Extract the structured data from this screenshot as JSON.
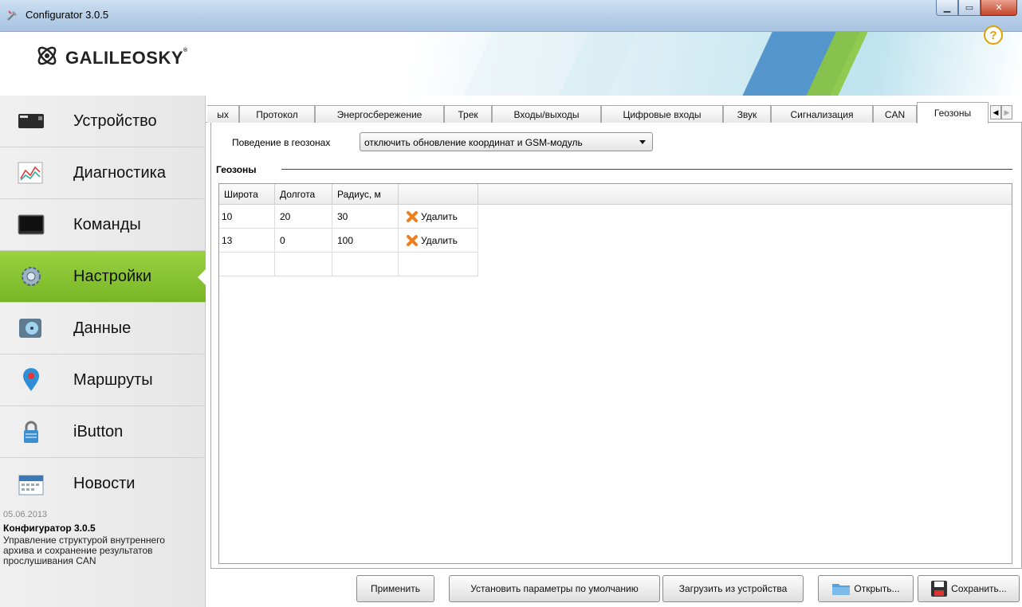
{
  "window": {
    "title": "Configurator 3.0.5"
  },
  "header": {
    "brand": "GALILEOSKY",
    "brand_mark": "®"
  },
  "sidebar": {
    "items": [
      {
        "label": "Устройство",
        "icon": "device-icon"
      },
      {
        "label": "Диагностика",
        "icon": "diagnostics-icon"
      },
      {
        "label": "Команды",
        "icon": "console-icon"
      },
      {
        "label": "Настройки",
        "icon": "gear-icon",
        "active": true
      },
      {
        "label": "Данные",
        "icon": "data-icon"
      },
      {
        "label": "Маршруты",
        "icon": "map-pin-icon"
      },
      {
        "label": "iButton",
        "icon": "lock-icon"
      },
      {
        "label": "Новости",
        "icon": "calendar-icon"
      }
    ],
    "news": {
      "date": "05.06.2013",
      "title": "Конфигуратор 3.0.5",
      "text": "Управление структурой внутреннего архива и сохранение результатов прослушивания CAN"
    }
  },
  "tabs": [
    {
      "label": "ых"
    },
    {
      "label": "Протокол"
    },
    {
      "label": "Энергосбережение"
    },
    {
      "label": "Трек"
    },
    {
      "label": "Входы/выходы"
    },
    {
      "label": "Цифровые входы"
    },
    {
      "label": "Звук"
    },
    {
      "label": "Сигнализация"
    },
    {
      "label": "CAN"
    },
    {
      "label": "Геозоны",
      "active": true
    }
  ],
  "settings": {
    "behavior_label": "Поведение в геозонах",
    "behavior_value": "отключить обновление координат и GSM-модуль",
    "group_title": "Геозоны"
  },
  "geozones_table": {
    "columns": [
      "Широта",
      "Долгота",
      "Радиус, м"
    ],
    "rows": [
      {
        "lat": "10",
        "lon": "20",
        "radius": "30",
        "action": "Удалить"
      },
      {
        "lat": "13",
        "lon": "0",
        "radius": "100",
        "action": "Удалить"
      }
    ]
  },
  "buttons": {
    "apply": "Применить",
    "defaults": "Установить параметры по умолчанию",
    "load": "Загрузить из устройства",
    "open": "Открыть...",
    "save": "Сохранить..."
  },
  "colors": {
    "accent_green": "#8cc63f",
    "delete_orange": "#f07d1e",
    "help_yellow": "#e0a100"
  }
}
